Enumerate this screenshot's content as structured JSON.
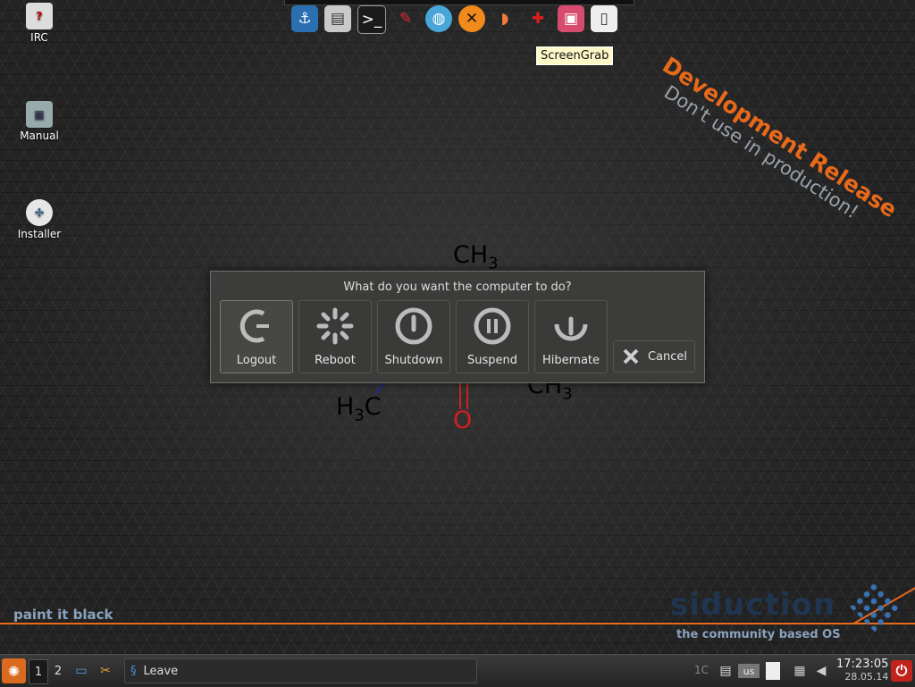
{
  "desktop": {
    "icons": [
      {
        "label": "IRC"
      },
      {
        "label": "Manual"
      },
      {
        "label": "Installer"
      }
    ],
    "watermark": {
      "title": "Development Release",
      "subtitle": "Don't use in production!"
    },
    "wallpaper": {
      "slogan": "paint it black",
      "logo": "siduction",
      "tagline": "the community based OS",
      "molecule": {
        "top": "CH",
        "top_sub": "3",
        "left": "H",
        "left_sub": "3",
        "left_c": "C",
        "right": "CH",
        "right_sub": "3",
        "oxygen": "O"
      }
    },
    "colors": {
      "accent": "#e8691a",
      "dialog_bg": "#3c3c3a",
      "tooltip_bg": "#fdf8c8"
    }
  },
  "dock": {
    "items": [
      {
        "name": "anchor-icon"
      },
      {
        "name": "file-cabinet-icon"
      },
      {
        "name": "terminal-icon"
      },
      {
        "name": "pen-icon"
      },
      {
        "name": "globe-icon"
      },
      {
        "name": "xchat-icon"
      },
      {
        "name": "melon-icon"
      },
      {
        "name": "paint-icon"
      },
      {
        "name": "screengrab-icon"
      },
      {
        "name": "phone-icon"
      }
    ],
    "tooltip": "ScreenGrab"
  },
  "dialog": {
    "title": "What do you want the computer to do?",
    "actions": [
      {
        "label": "Logout"
      },
      {
        "label": "Reboot"
      },
      {
        "label": "Shutdown"
      },
      {
        "label": "Suspend"
      },
      {
        "label": "Hibernate"
      }
    ],
    "cancel": "Cancel"
  },
  "taskbar": {
    "workspaces": [
      "1",
      "2"
    ],
    "task": "Leave",
    "tray_temp": "1C",
    "keyboard_layout": "us",
    "time": "17:23:05",
    "date": "28.05.14"
  }
}
